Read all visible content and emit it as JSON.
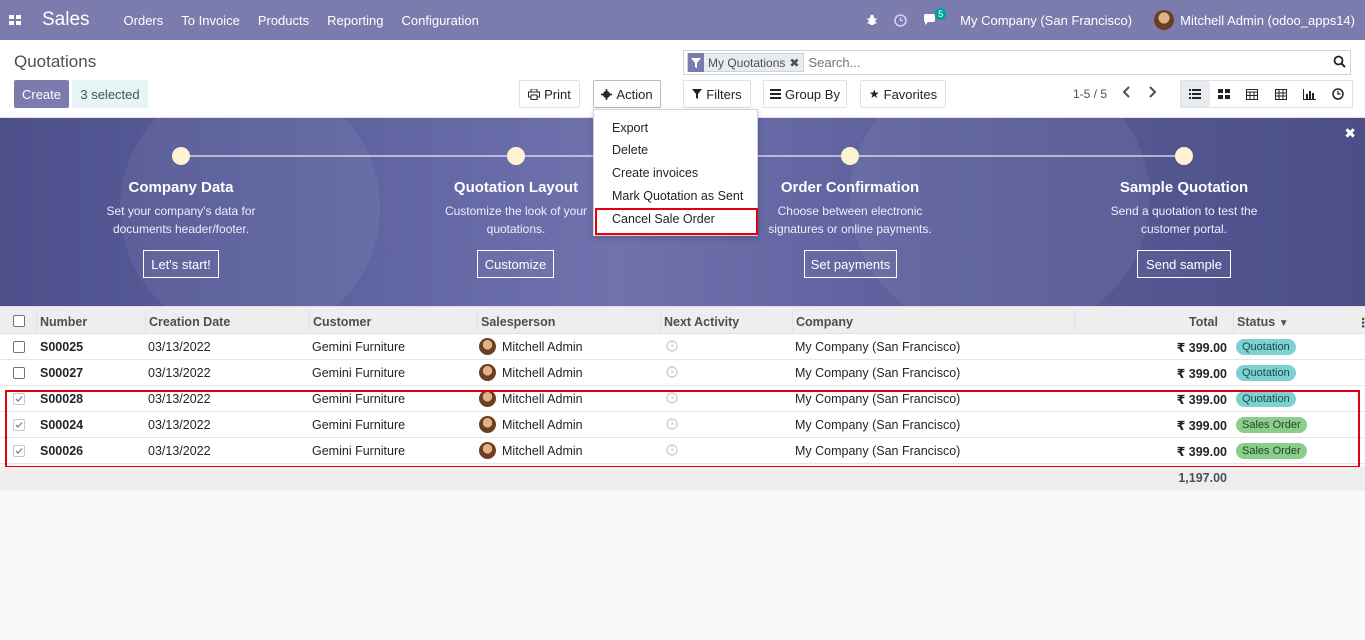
{
  "topbar": {
    "app_title": "Sales",
    "menu": [
      "Orders",
      "To Invoice",
      "Products",
      "Reporting",
      "Configuration"
    ],
    "messages_badge": "5",
    "company": "My Company (San Francisco)",
    "user": "Mitchell Admin (odoo_apps14)",
    "bg_color": "#7c7bad"
  },
  "control_panel": {
    "breadcrumb": "Quotations",
    "create_label": "Create",
    "selected_label": "3 selected",
    "print_label": "Print",
    "action_label": "Action",
    "filters_label": "Filters",
    "groupby_label": "Group By",
    "favorites_label": "Favorites",
    "pager": "1-5 / 5",
    "search": {
      "facet": "My Quotations",
      "placeholder": "Search..."
    }
  },
  "action_menu": {
    "items": [
      "Export",
      "Delete",
      "Create invoices",
      "Mark Quotation as Sent",
      "Cancel Sale Order"
    ],
    "highlighted": "Cancel Sale Order"
  },
  "banner": {
    "steps": [
      {
        "title": "Company Data",
        "desc_1": "Set your company's data for",
        "desc_2": "documents header/footer.",
        "button": "Let's start!"
      },
      {
        "title": "Quotation Layout",
        "desc_1": "Customize the look of your",
        "desc_2": "quotations.",
        "button": "Customize"
      },
      {
        "title": "Order Confirmation",
        "desc_1": "Choose between electronic",
        "desc_2": "signatures or online payments.",
        "button": "Set payments"
      },
      {
        "title": "Sample Quotation",
        "desc_1": "Send a quotation to test the",
        "desc_2": "customer portal.",
        "button": "Send sample"
      }
    ]
  },
  "table": {
    "headers": [
      "Number",
      "Creation Date",
      "Customer",
      "Salesperson",
      "Next Activity",
      "Company",
      "Total",
      "Status"
    ],
    "rows": [
      {
        "number": "S00025",
        "date": "03/13/2022",
        "customer": "Gemini Furniture",
        "salesperson": "Mitchell Admin",
        "company": "My Company (San Francisco)",
        "total": "₹ 399.00",
        "status": "Quotation",
        "checked": false
      },
      {
        "number": "S00027",
        "date": "03/13/2022",
        "customer": "Gemini Furniture",
        "salesperson": "Mitchell Admin",
        "company": "My Company (San Francisco)",
        "total": "₹ 399.00",
        "status": "Quotation",
        "checked": false
      },
      {
        "number": "S00028",
        "date": "03/13/2022",
        "customer": "Gemini Furniture",
        "salesperson": "Mitchell Admin",
        "company": "My Company (San Francisco)",
        "total": "₹ 399.00",
        "status": "Quotation",
        "checked": true
      },
      {
        "number": "S00024",
        "date": "03/13/2022",
        "customer": "Gemini Furniture",
        "salesperson": "Mitchell Admin",
        "company": "My Company (San Francisco)",
        "total": "₹ 399.00",
        "status": "Sales Order",
        "checked": true
      },
      {
        "number": "S00026",
        "date": "03/13/2022",
        "customer": "Gemini Furniture",
        "salesperson": "Mitchell Admin",
        "company": "My Company (San Francisco)",
        "total": "₹ 399.00",
        "status": "Sales Order",
        "checked": true
      }
    ],
    "sum_total": "1,197.00"
  }
}
